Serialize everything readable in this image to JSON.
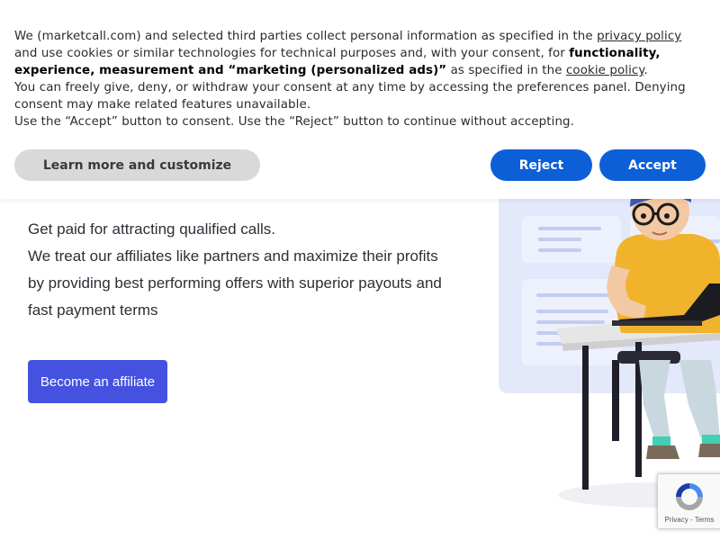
{
  "cookie_banner": {
    "line1_text": "We (marketcall.com) and selected third parties collect personal information as specified in the ",
    "privacy_link": "privacy policy",
    "line2_text": "and use cookies or similar technologies for technical purposes and, with your consent, for ",
    "line2_bold": "functionality,",
    "line3_bold": "experience, measurement and “marketing (personalized ads)”",
    "line3_text": " as specified in the ",
    "cookie_link": "cookie policy",
    "line3_end": ".",
    "line4": "You can freely give, deny, or withdraw your consent at any time by accessing the preferences panel. Denying",
    "line5": "consent may make related features unavailable.",
    "line6": "Use the “Accept” button to consent. Use the “Reject” button to continue without accepting.",
    "learn_more_label": "Learn more and customize",
    "reject_label": "Reject",
    "accept_label": "Accept",
    "colors": {
      "primary_button": "#0d5fd8",
      "secondary_button": "#d9d9d9"
    }
  },
  "hero": {
    "lines": [
      "Get paid for attracting qualified calls.",
      "We treat our affiliates like partners and maximize their profits",
      "by providing best performing offers with superior payouts and",
      "fast payment terms"
    ],
    "cta_label": "Become an affiliate",
    "colors": {
      "cta": "#4552e0"
    }
  },
  "recaptcha": {
    "links": "Privacy - Terms",
    "icon": "recaptcha-icon"
  }
}
